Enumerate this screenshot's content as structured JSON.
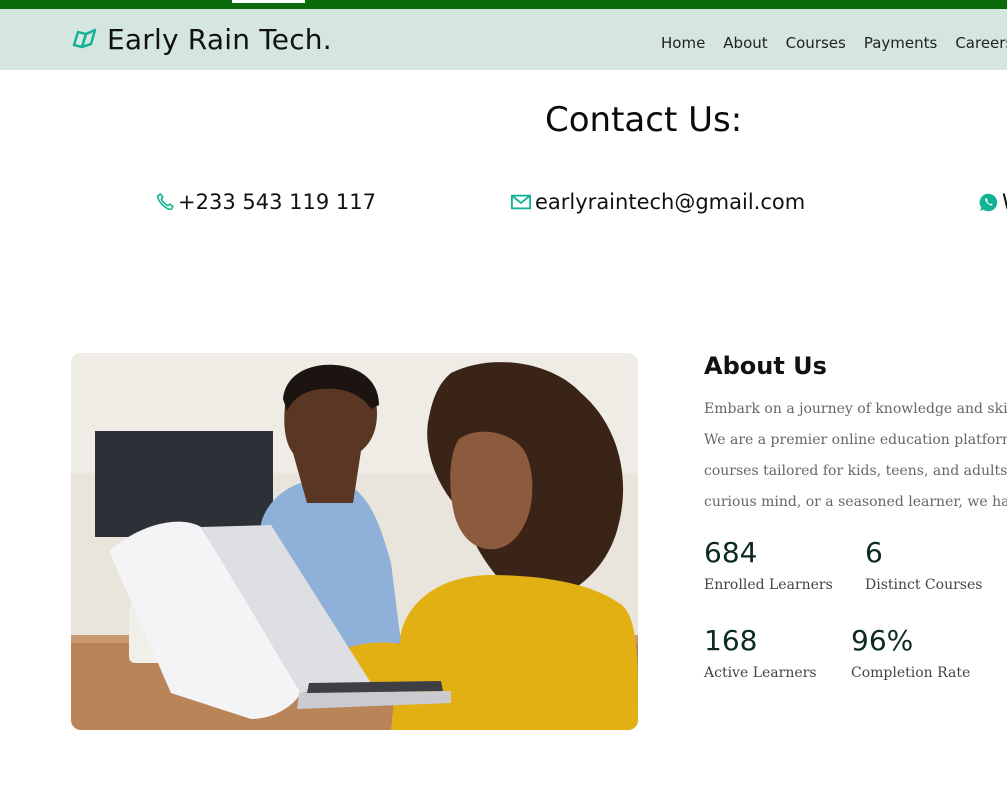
{
  "brand": {
    "name": "Early Rain Tech.",
    "icon": "book-logo-icon"
  },
  "nav": {
    "items": [
      "Home",
      "About",
      "Courses",
      "Payments",
      "Careers"
    ]
  },
  "contact": {
    "title": "Contact Us:",
    "phone": "+233 543 119 117",
    "email": "earlyraintech@gmail.com",
    "whatsapp": "W"
  },
  "about": {
    "title": "About Us",
    "lines": [
      "Embark on a journey of knowledge and skill de",
      "We are a premier online education platform of",
      "courses tailored for kids, teens, and adults. Wh",
      "curious mind, or a seasoned learner, we have so"
    ]
  },
  "stats": [
    {
      "value": "684",
      "label": "Enrolled Learners"
    },
    {
      "value": "6",
      "label": "Distinct Courses"
    },
    {
      "value": "168",
      "label": "Active Learners"
    },
    {
      "value": "96%",
      "label": "Completion Rate"
    }
  ],
  "colors": {
    "accent": "#12b394",
    "top_strip": "#0b6b0b",
    "navbar": "#d5e6e1"
  }
}
